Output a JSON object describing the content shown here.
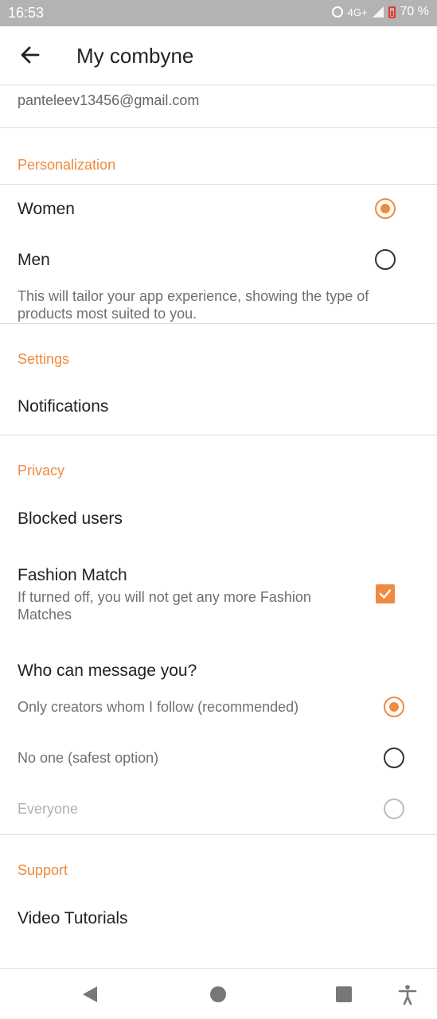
{
  "status_bar": {
    "time": "16:53",
    "network": "4G+",
    "battery": "70 %"
  },
  "app_bar": {
    "title": "My combyne"
  },
  "account": {
    "email": "panteleev13456@gmail.com"
  },
  "personalization": {
    "header": "Personalization",
    "options": [
      {
        "label": "Women",
        "selected": true
      },
      {
        "label": "Men",
        "selected": false
      }
    ],
    "description": "This will tailor your app experience, showing the type of products most suited to you."
  },
  "settings": {
    "header": "Settings",
    "notifications_label": "Notifications"
  },
  "privacy": {
    "header": "Privacy",
    "blocked_users_label": "Blocked users",
    "fashion_match": {
      "label": "Fashion Match",
      "description": "If turned off, you will not get any more Fashion Matches",
      "checked": true
    },
    "message": {
      "question": "Who can message you?",
      "options": [
        {
          "label": "Only creators whom I follow (recommended)",
          "selected": true
        },
        {
          "label": "No one (safest option)",
          "selected": false
        },
        {
          "label": "Everyone",
          "selected": false,
          "disabled": true
        }
      ]
    }
  },
  "support": {
    "header": "Support",
    "video_tutorials_label": "Video Tutorials"
  },
  "colors": {
    "accent": "#ef8a3e",
    "status_bar": "#b3b3b3",
    "divider": "#dddddd"
  },
  "icons": {
    "back": "arrow-left-icon",
    "nav_back": "triangle-back-icon",
    "nav_home": "circle-home-icon",
    "nav_recent": "square-recent-icon",
    "accessibility": "accessibility-icon"
  }
}
